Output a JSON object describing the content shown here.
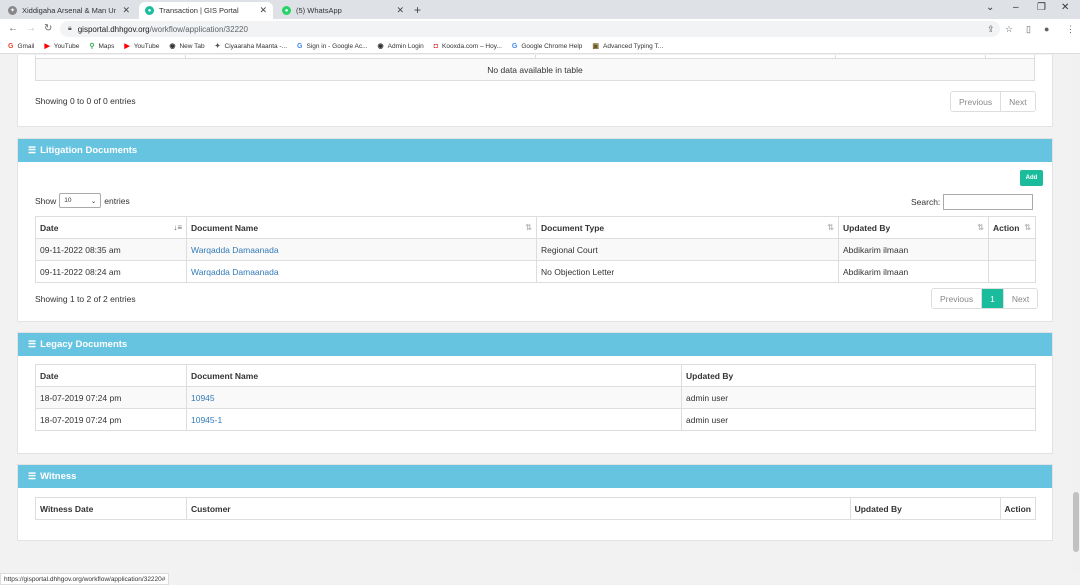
{
  "browser": {
    "tabs": [
      {
        "title": "Xiddigaha Arsenal & Man United",
        "active": false
      },
      {
        "title": "Transaction | GIS Portal",
        "active": true
      },
      {
        "title": "(5) WhatsApp",
        "active": false
      }
    ],
    "url_host": "gisportal.dhhgov.org",
    "url_path": "/workflow/application/32220",
    "bookmarks": [
      "Gmail",
      "YouTube",
      "Maps",
      "YouTube",
      "New Tab",
      "Ciyaaraha Maanta -...",
      "Sign in - Google Ac...",
      "Admin Login",
      "Kooxda.com – Hoy...",
      "Google Chrome Help",
      "Advanced Typing T..."
    ],
    "status_url": "https://gisportal.dhhgov.org/workflow/application/32220#"
  },
  "top_section": {
    "empty_message": "No data available in table",
    "info": "Showing 0 to 0 of 0 entries",
    "prev": "Previous",
    "next": "Next"
  },
  "litigation": {
    "title": "Litigation Documents",
    "add_label": "Add",
    "show_label": "Show",
    "entries_label": "entries",
    "page_length": "10",
    "search_label": "Search:",
    "columns": [
      "Date",
      "Document Name",
      "Document Type",
      "Updated By",
      "Action"
    ],
    "rows": [
      {
        "date": "09-11-2022 08:35 am",
        "name": "Warqadda Damaanada",
        "type": "Regional Court",
        "by": "Abdikarim ilmaan"
      },
      {
        "date": "09-11-2022 08:24 am",
        "name": "Warqadda Damaanada",
        "type": "No Objection Letter",
        "by": "Abdikarim ilmaan"
      }
    ],
    "info": "Showing 1 to 2 of 2 entries",
    "prev": "Previous",
    "page": "1",
    "next": "Next"
  },
  "legacy": {
    "title": "Legacy Documents",
    "columns": [
      "Date",
      "Document Name",
      "Updated By"
    ],
    "rows": [
      {
        "date": "18-07-2019 07:24 pm",
        "name": "10945",
        "by": "admin user"
      },
      {
        "date": "18-07-2019 07:24 pm",
        "name": "10945-1",
        "by": "admin user"
      }
    ]
  },
  "witness": {
    "title": "Witness",
    "columns": [
      "Witness Date",
      "Customer",
      "Updated By",
      "Action"
    ]
  },
  "colors": {
    "header": "#67c4e1",
    "accent": "#1abc9c",
    "link": "#337ab7"
  }
}
